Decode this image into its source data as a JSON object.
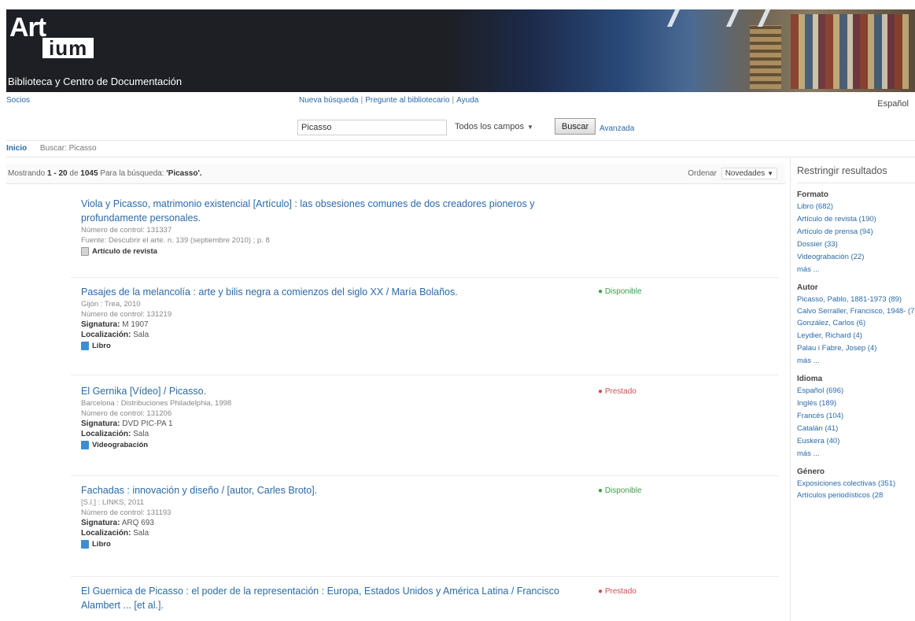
{
  "header": {
    "logo_art": "Art",
    "logo_tum": "ium",
    "subtitle": "Biblioteca y Centro de Documentación"
  },
  "topbar": {
    "socios": "Socios",
    "nav": [
      "Nueva búsqueda",
      "Pregunte al bibliotecario",
      "Ayuda"
    ],
    "language": "Español"
  },
  "search": {
    "value": "Picasso",
    "field_select": "Todos los campos",
    "button": "Buscar",
    "advanced": "Avanzada"
  },
  "breadcrumb": {
    "home": "Inicio",
    "current": "Buscar: Picasso"
  },
  "results_header": {
    "showing": "Mostrando",
    "range": "1 - 20",
    "of": "de",
    "total": "1045",
    "for_search": "Para la búsqueda:",
    "query": "'Picasso'.",
    "sort_label": "Ordenar",
    "sort_value": "Novedades"
  },
  "results": [
    {
      "title": "Viola y Picasso, matrimonio existencial [Artículo] : las obsesiones comunes de dos creadores pioneros y profundamente personales.",
      "control": "Número de control: 131337",
      "source": "Fuente: Descubrir el arte. n. 139 (septiembre 2010) ; p. 8",
      "type": "Artículo de revista"
    },
    {
      "title": "Pasajes de la melancolía : arte y bilis negra a comienzos del siglo XX / María Bolaños.",
      "pub": "Gijón : Trea, 2010",
      "control": "Número de control: 131219",
      "signatura_label": "Signatura:",
      "signatura": "M 1907",
      "loc_label": "Localización:",
      "loc": "Sala",
      "type": "Libro",
      "status": "Disponible"
    },
    {
      "title": "El Gernika [Vídeo] / Picasso.",
      "pub": "Barcelona : Distribuciones Philadelphia, 1998",
      "control": "Número de control: 131206",
      "signatura_label": "Signatura:",
      "signatura": "DVD PIC-PA 1",
      "loc_label": "Localización:",
      "loc": "Sala",
      "type": "Videograbación",
      "status": "Prestado"
    },
    {
      "title": "Fachadas : innovación y diseño / [autor, Carles Broto].",
      "pub": "[S.l.] : LINKS, 2011",
      "control": "Número de control: 131193",
      "signatura_label": "Signatura:",
      "signatura": "ARQ 693",
      "loc_label": "Localización:",
      "loc": "Sala",
      "type": "Libro",
      "status": "Disponible"
    },
    {
      "title": "El Guernica de Picasso : el poder de la representación : Europa, Estados Unidos y América Latina / Francisco Alambert ... [et al.].",
      "status": "Prestado"
    }
  ],
  "sidebar": {
    "heading": "Restringir resultados",
    "facets": [
      {
        "title": "Formato",
        "items": [
          "Libro (682)",
          "Artículo de revista (190)",
          "Artículo de prensa (94)",
          "Dossier (33)",
          "Videograbación (22)"
        ],
        "more": "más ..."
      },
      {
        "title": "Autor",
        "items": [
          "Picasso, Pablo, 1881-1973 (89)",
          "Calvo Serraller, Francisco, 1948- (7)",
          "González, Carlos (6)",
          "Leydier, Richard (4)",
          "Palau i Fabre, Josep (4)"
        ],
        "more": "más ..."
      },
      {
        "title": "Idioma",
        "items": [
          "Español (696)",
          "Inglés (189)",
          "Francés (104)",
          "Catalán (41)",
          "Euskera (40)"
        ],
        "more": "más ..."
      },
      {
        "title": "Género",
        "items": [
          "Exposiciones colectivas (351)",
          "Artículos periodísticos (28"
        ]
      }
    ]
  }
}
